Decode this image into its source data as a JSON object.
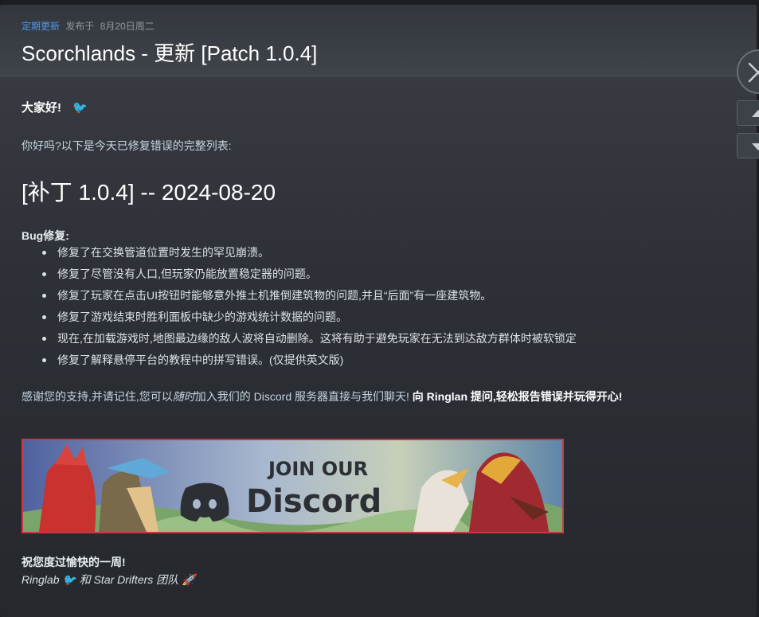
{
  "header": {
    "tag": "定期更新",
    "posted": "发布于",
    "date": "8月20日周二",
    "title": "Scorchlands - 更新 [Patch 1.0.4]"
  },
  "body": {
    "greeting": "大家好!",
    "intro": "你好吗?以下是今天已修复错误的完整列表:",
    "patch_heading": "[补丁 1.0.4] -- 2024-08-20",
    "bug_label": "Bug修复:",
    "bug_items": [
      "修复了在交换管道位置时发生的罕见崩溃。",
      "修复了尽管没有人口,但玩家仍能放置稳定器的问题。",
      "修复了玩家在点击UI按钮时能够意外推土机推倒建筑物的问题,并且“后面”有一座建筑物。",
      "修复了游戏结束时胜利面板中缺少的游戏统计数据的问题。",
      "现在,在加载游戏时,地图最边缘的敌人波将自动删除。这将有助于避免玩家在无法到达敌方群体时被软锁定",
      "修复了解释悬停平台的教程中的拼写错误。(仅提供英文版)"
    ],
    "thanks_a": "感谢您的支持,并请记住,您可以",
    "thanks_italic": "随时",
    "thanks_b": "加入我们的 Discord 服务器直接与我们聊天!",
    "thanks_bold": "向 Ringlan 提问,轻松报告错误并玩得开心!",
    "banner_line1": "JOIN OUR",
    "banner_line2": "Discord",
    "farewell": "祝您度过愉快的一周!",
    "sig_a": "Ringlab",
    "sig_b": "和 Star Drifters 团队"
  },
  "colors": {
    "tag": "#4c9be8",
    "banner_border": "#c53a45"
  },
  "icons": [
    "bird-emoji-icon",
    "rocket-emoji-icon",
    "close-icon",
    "arrow-up-icon",
    "arrow-down-icon",
    "discord-logo-icon"
  ]
}
